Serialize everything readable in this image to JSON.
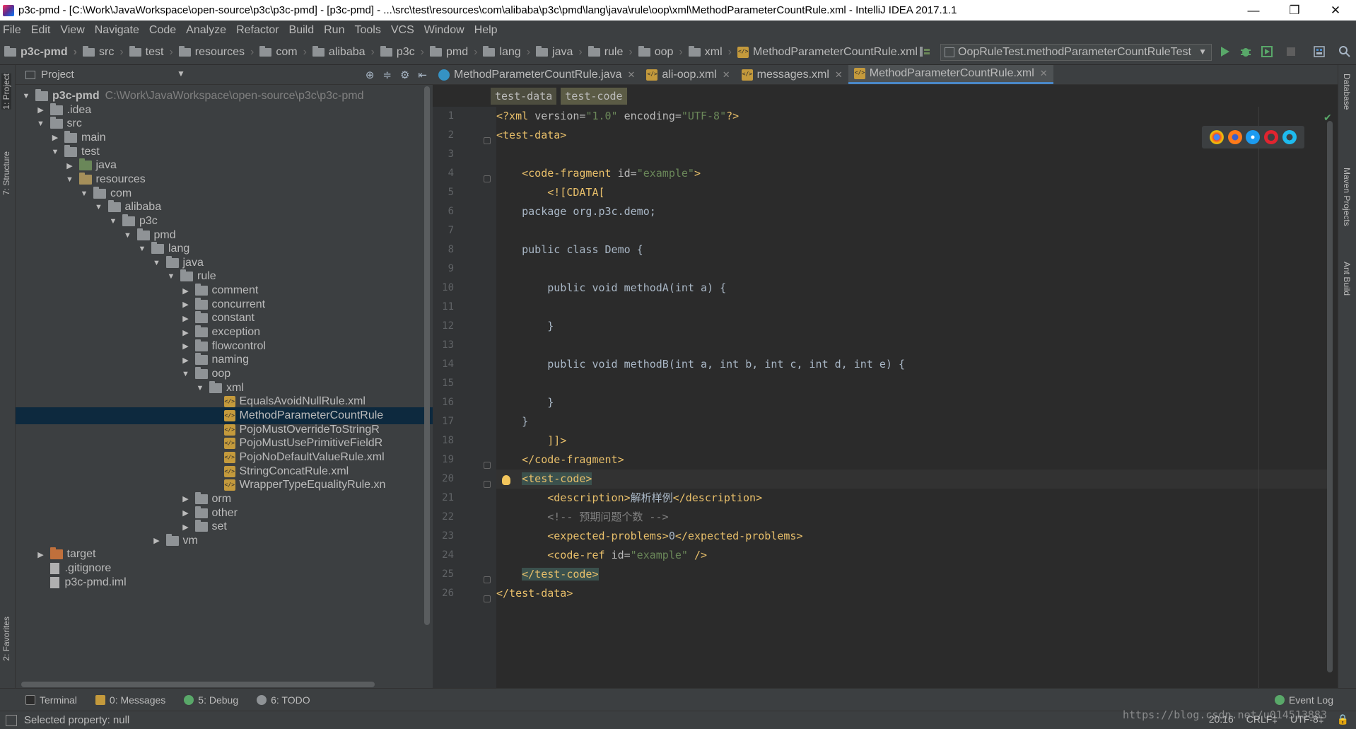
{
  "window": {
    "title": "p3c-pmd - [C:\\Work\\JavaWorkspace\\open-source\\p3c\\p3c-pmd] - [p3c-pmd] - ...\\src\\test\\resources\\com\\alibaba\\p3c\\pmd\\lang\\java\\rule\\oop\\xml\\MethodParameterCountRule.xml - IntelliJ IDEA 2017.1.1",
    "controls": [
      "—",
      "❐",
      "✕"
    ]
  },
  "menu": [
    "File",
    "Edit",
    "View",
    "Navigate",
    "Code",
    "Analyze",
    "Refactor",
    "Build",
    "Run",
    "Tools",
    "VCS",
    "Window",
    "Help"
  ],
  "navbar": {
    "crumbs": [
      "p3c-pmd",
      "src",
      "test",
      "resources",
      "com",
      "alibaba",
      "p3c",
      "pmd",
      "lang",
      "java",
      "rule",
      "oop",
      "xml",
      "MethodParameterCountRule.xml"
    ],
    "run_config": "OopRuleTest.methodParameterCountRuleTest"
  },
  "left_strip": {
    "project_tab": "1: Project",
    "structure_tab": "7: Structure",
    "favorites_tab": "2: Favorites"
  },
  "project": {
    "header": "Project",
    "root_name": "p3c-pmd",
    "root_path": "C:\\Work\\JavaWorkspace\\open-source\\p3c\\p3c-pmd",
    "tree": [
      {
        "label": ".idea",
        "level": 1,
        "open": false,
        "icon": "folder"
      },
      {
        "label": "src",
        "level": 1,
        "open": true,
        "icon": "folder"
      },
      {
        "label": "main",
        "level": 2,
        "open": false,
        "icon": "folder"
      },
      {
        "label": "test",
        "level": 2,
        "open": true,
        "icon": "folder"
      },
      {
        "label": "java",
        "level": 3,
        "open": false,
        "icon": "green"
      },
      {
        "label": "resources",
        "level": 3,
        "open": true,
        "icon": "res"
      },
      {
        "label": "com",
        "level": 4,
        "open": true,
        "icon": "folder"
      },
      {
        "label": "alibaba",
        "level": 5,
        "open": true,
        "icon": "folder"
      },
      {
        "label": "p3c",
        "level": 6,
        "open": true,
        "icon": "folder"
      },
      {
        "label": "pmd",
        "level": 7,
        "open": true,
        "icon": "folder"
      },
      {
        "label": "lang",
        "level": 8,
        "open": true,
        "icon": "folder"
      },
      {
        "label": "java",
        "level": 9,
        "open": true,
        "icon": "folder"
      },
      {
        "label": "rule",
        "level": 10,
        "open": true,
        "icon": "folder"
      },
      {
        "label": "comment",
        "level": 11,
        "open": false,
        "icon": "folder"
      },
      {
        "label": "concurrent",
        "level": 11,
        "open": false,
        "icon": "folder"
      },
      {
        "label": "constant",
        "level": 11,
        "open": false,
        "icon": "folder"
      },
      {
        "label": "exception",
        "level": 11,
        "open": false,
        "icon": "folder"
      },
      {
        "label": "flowcontrol",
        "level": 11,
        "open": false,
        "icon": "folder"
      },
      {
        "label": "naming",
        "level": 11,
        "open": false,
        "icon": "folder"
      },
      {
        "label": "oop",
        "level": 11,
        "open": true,
        "icon": "folder"
      },
      {
        "label": "xml",
        "level": 12,
        "open": true,
        "icon": "folder"
      },
      {
        "label": "EqualsAvoidNullRule.xml",
        "level": 13,
        "icon": "xml"
      },
      {
        "label": "MethodParameterCountRule",
        "level": 13,
        "icon": "xml",
        "selected": true
      },
      {
        "label": "PojoMustOverrideToStringR",
        "level": 13,
        "icon": "xml"
      },
      {
        "label": "PojoMustUsePrimitiveFieldR",
        "level": 13,
        "icon": "xml"
      },
      {
        "label": "PojoNoDefaultValueRule.xml",
        "level": 13,
        "icon": "xml"
      },
      {
        "label": "StringConcatRule.xml",
        "level": 13,
        "icon": "xml"
      },
      {
        "label": "WrapperTypeEqualityRule.xn",
        "level": 13,
        "icon": "xml"
      },
      {
        "label": "orm",
        "level": 11,
        "open": false,
        "icon": "folder"
      },
      {
        "label": "other",
        "level": 11,
        "open": false,
        "icon": "folder"
      },
      {
        "label": "set",
        "level": 11,
        "open": false,
        "icon": "folder"
      },
      {
        "label": "vm",
        "level": 9,
        "open": false,
        "icon": "folder"
      },
      {
        "label": "target",
        "level": 1,
        "open": false,
        "icon": "orange"
      },
      {
        "label": ".gitignore",
        "level": 1,
        "icon": "doc"
      },
      {
        "label": "p3c-pmd.iml",
        "level": 1,
        "icon": "doc"
      }
    ]
  },
  "editor": {
    "tabs": [
      {
        "label": "MethodParameterCountRule.java",
        "icon": "java"
      },
      {
        "label": "ali-oop.xml",
        "icon": "xml"
      },
      {
        "label": "messages.xml",
        "icon": "xml"
      },
      {
        "label": "MethodParameterCountRule.xml",
        "icon": "xml",
        "active": true
      }
    ],
    "breadcrumb": [
      "test-data",
      "test-code"
    ],
    "caret_line": 20,
    "lines": [
      "1",
      "2",
      "3",
      "4",
      "5",
      "6",
      "7",
      "8",
      "9",
      "10",
      "11",
      "12",
      "13",
      "14",
      "15",
      "16",
      "17",
      "18",
      "19",
      "20",
      "21",
      "22",
      "23",
      "24",
      "25",
      "26"
    ]
  },
  "right_strip": {
    "database_tab": "Database",
    "maven_tab": "Maven Projects",
    "ant_tab": "Ant Build"
  },
  "bottom_tabs": [
    "Terminal",
    "0: Messages",
    "5: Debug",
    "6: TODO"
  ],
  "event_log": "Event Log",
  "status": {
    "message": "Selected property: null",
    "position": "20:16",
    "line_sep": "CRLF‡",
    "encoding": "UTF-8‡"
  },
  "watermark": "https://blog.csdn.net/u014513883",
  "colors": {
    "tag": "#e8bf6a",
    "string": "#6a8759",
    "comment": "#808080",
    "selection": "#0d293e",
    "accent": "#4a88c7"
  }
}
